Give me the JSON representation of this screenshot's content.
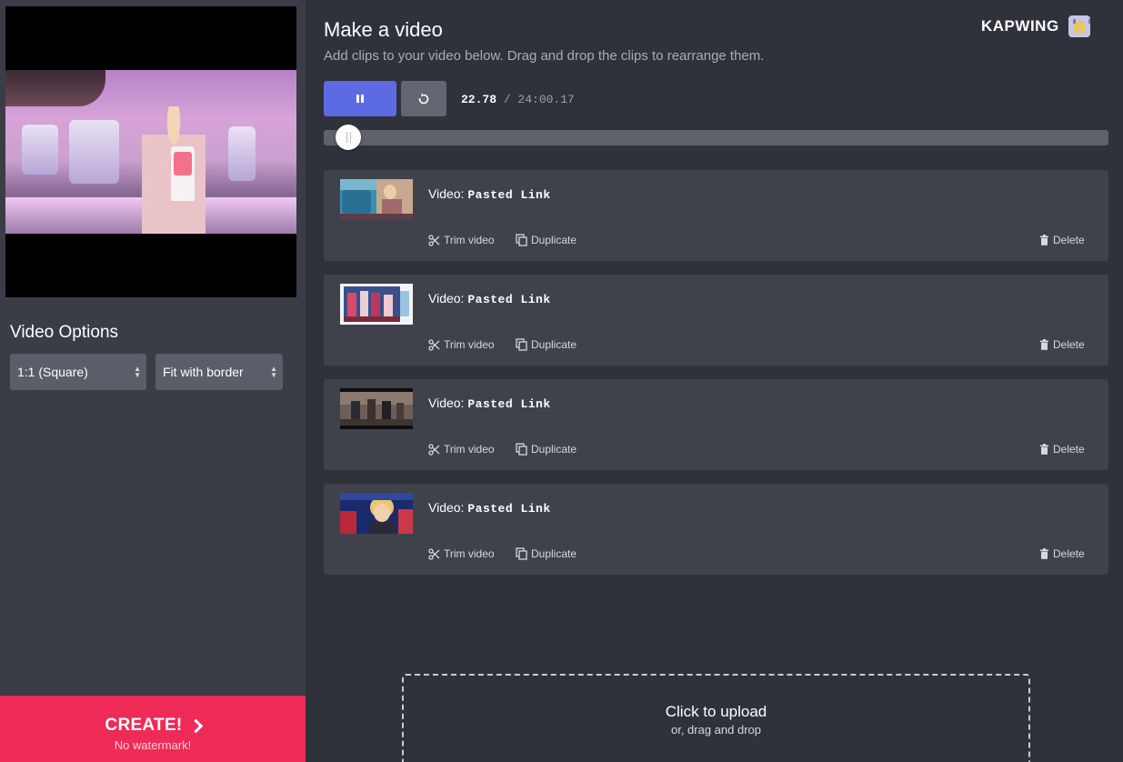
{
  "sidebar": {
    "video_options_title": "Video Options",
    "aspect_select": {
      "value": "1:1 (Square)"
    },
    "fit_select": {
      "value": "Fit with border"
    },
    "create": {
      "label": "CREATE!",
      "sublabel": "No watermark!"
    }
  },
  "header": {
    "title": "Make a video",
    "subtitle": "Add clips to your video below. Drag and drop the clips to rearrange them.",
    "brand": "KAPWING"
  },
  "player": {
    "current_time": "22.78",
    "separator": " / ",
    "total_time": "24:00.17",
    "progress": 0.0158
  },
  "clip_labels": {
    "prefix": "Video:",
    "trim": "Trim video",
    "duplicate": "Duplicate",
    "delete": "Delete"
  },
  "clips": [
    {
      "source": "Pasted Link"
    },
    {
      "source": "Pasted Link"
    },
    {
      "source": "Pasted Link"
    },
    {
      "source": "Pasted Link"
    }
  ],
  "upload": {
    "title": "Click to upload",
    "subtitle": "or, drag and drop"
  },
  "colors": {
    "accent_blue": "#5c6be1",
    "create_red": "#ee2b57",
    "background": "#2f323a",
    "sidebar": "#3a3d46"
  }
}
